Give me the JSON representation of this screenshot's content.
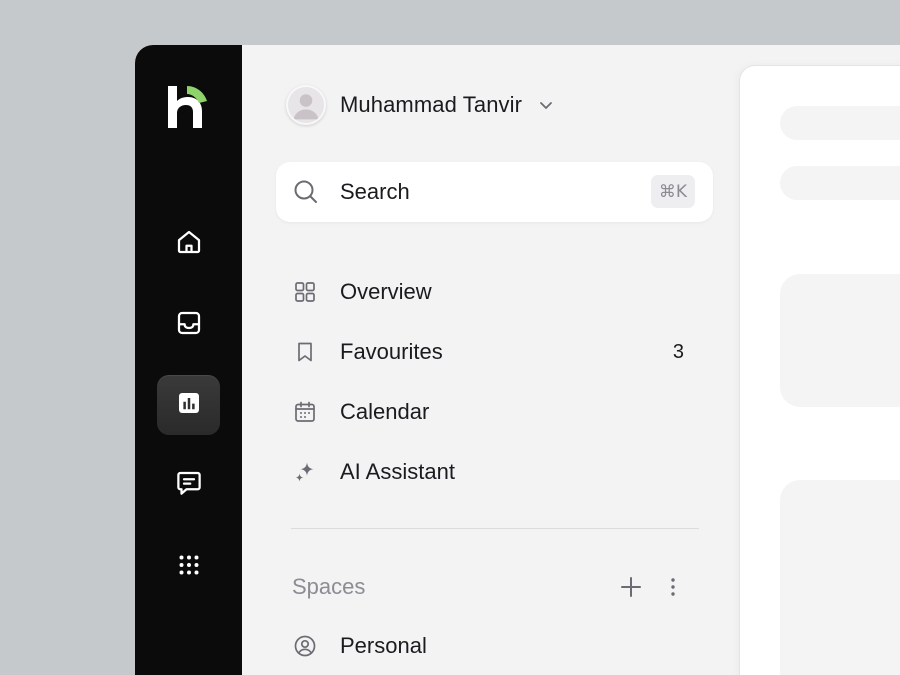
{
  "user": {
    "name": "Muhammad Tanvir"
  },
  "search": {
    "label": "Search",
    "shortcut": "⌘K"
  },
  "nav": [
    {
      "label": "Overview",
      "icon": "grid-icon"
    },
    {
      "label": "Favourites",
      "icon": "bookmark-icon",
      "count": "3"
    },
    {
      "label": "Calendar",
      "icon": "calendar-icon"
    },
    {
      "label": "AI Assistant",
      "icon": "sparkle-icon"
    }
  ],
  "spaces": {
    "title": "Spaces",
    "items": [
      {
        "label": "Personal",
        "icon": "user-circle-icon"
      }
    ]
  },
  "rail": {
    "items": [
      "home-icon",
      "inbox-icon",
      "chart-icon",
      "chat-icon",
      "apps-grid-icon"
    ],
    "active": "chart-icon"
  },
  "colors": {
    "rail_bg": "#0b0b0b",
    "panel_bg": "#f3f3f4",
    "logo_accent": "#8fd36b",
    "text": "#1b1b1f",
    "muted": "#8c8c94"
  }
}
